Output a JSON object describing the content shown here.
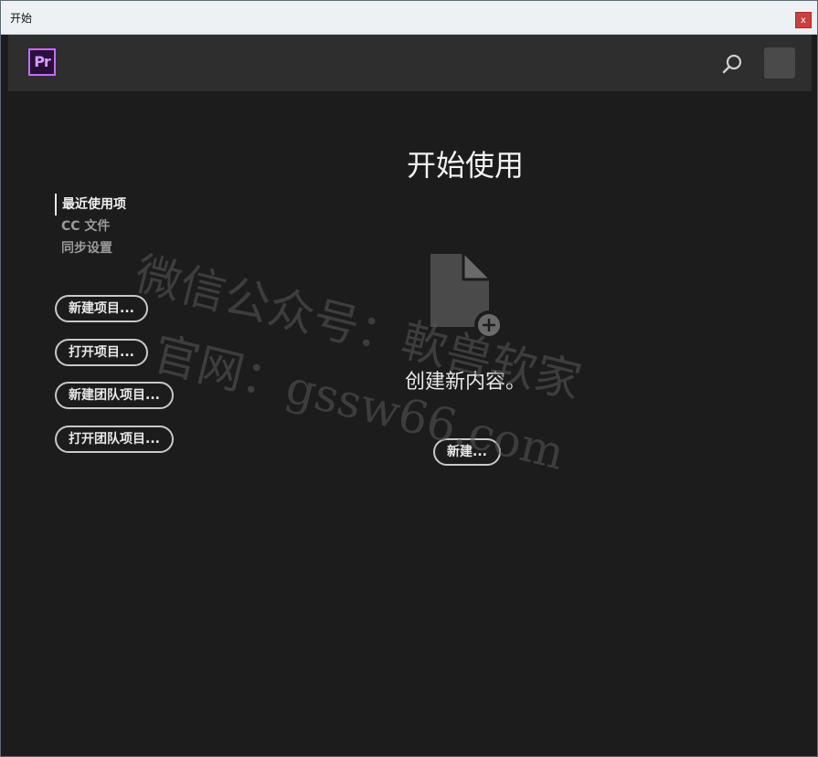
{
  "window": {
    "title": "开始",
    "close_label": "x"
  },
  "appbar": {
    "logo_text": "Pr",
    "search_icon": "search-icon"
  },
  "sidebar": {
    "nav_items": [
      {
        "label": "最近使用项",
        "active": true
      },
      {
        "label": "CC 文件",
        "active": false
      },
      {
        "label": "同步设置",
        "active": false
      }
    ],
    "buttons": [
      {
        "label": "新建项目..."
      },
      {
        "label": "打开项目..."
      },
      {
        "label": "新建团队项目..."
      },
      {
        "label": "打开团队项目..."
      }
    ]
  },
  "main": {
    "heading": "开始使用",
    "create_text": "创建新内容。",
    "new_button": "新建..."
  },
  "watermark": {
    "line1": "微信公众号：軟兽软家",
    "line2": "官网：gssw66.com"
  },
  "colors": {
    "accent": "#c36cff",
    "background": "#1c1c1c",
    "appbar": "#2e2e2e"
  }
}
